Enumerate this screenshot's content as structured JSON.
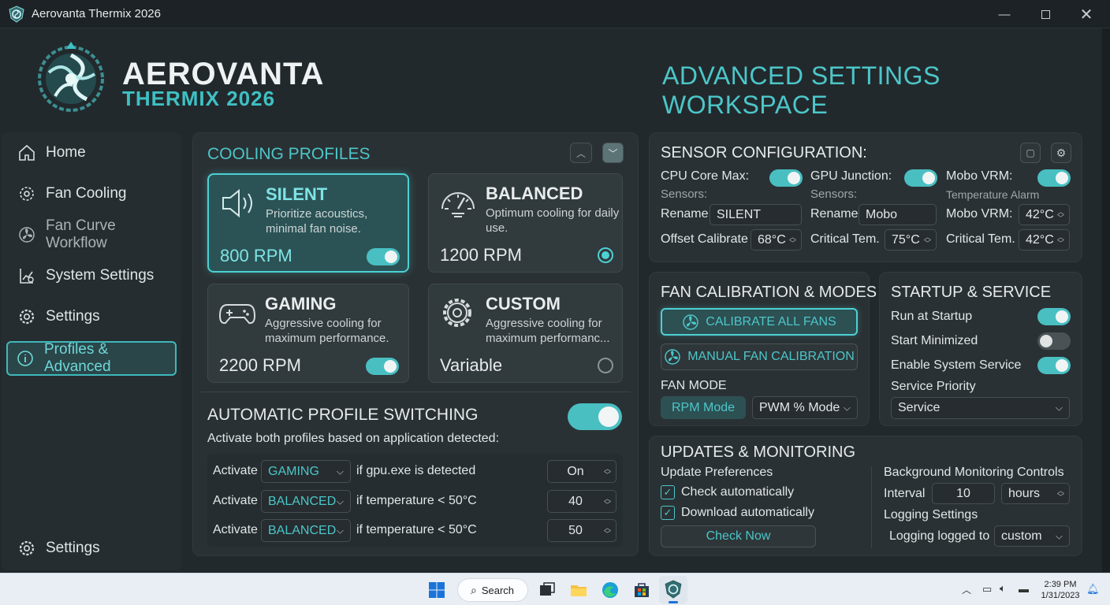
{
  "window": {
    "title": "Aerovanta Thermix 2026"
  },
  "brand": {
    "line1": "AEROVANTA",
    "line2": "THERMIX 2026"
  },
  "header": {
    "workspace_title": "ADVANCED SETTINGS WORKSPACE"
  },
  "sidebar": {
    "items": [
      {
        "label": "Home",
        "icon": "home-icon"
      },
      {
        "label": "Fan Cooling",
        "icon": "gear-fan-icon"
      },
      {
        "label": "Fan Curve Workflow",
        "icon": "fan-icon"
      },
      {
        "label": "System Settings",
        "icon": "system-settings-icon"
      },
      {
        "label": "Settings",
        "icon": "gear-icon"
      },
      {
        "label": "Profiles & Advanced",
        "icon": "info-icon",
        "active": true
      }
    ],
    "footer_label": "Settings"
  },
  "cooling_profiles": {
    "title": "COOLING PROFILES",
    "profiles": [
      {
        "name": "SILENT",
        "desc": "Prioritize acoustics, minimal fan noise.",
        "speed": "800 RPM",
        "control": "toggle",
        "on": true,
        "selected": true
      },
      {
        "name": "BALANCED",
        "desc": "Optimum cooling for daily use.",
        "speed": "1200 RPM",
        "control": "radio",
        "on": true
      },
      {
        "name": "GAMING",
        "desc": "Aggressive cooling for maximum performance.",
        "speed": "2200 RPM",
        "control": "toggle",
        "on": true
      },
      {
        "name": "CUSTOM",
        "desc": "Aggressive cooling for maximum performanc...",
        "speed": "Variable",
        "control": "radio",
        "on": false
      }
    ]
  },
  "auto_switch": {
    "title": "AUTOMATIC PROFILE SWITCHING",
    "subtitle": "Activate both profiles based on application detected:",
    "enabled": true,
    "rules": [
      {
        "prefix": "Activate",
        "profile": "GAMING",
        "condition": "if gpu.exe is detected",
        "value": "On"
      },
      {
        "prefix": "Activate",
        "profile": "BALANCED",
        "condition": "if temperature < 50°C",
        "value": "40"
      },
      {
        "prefix": "Activate",
        "profile": "BALANCED",
        "condition": "if temperature < 50°C",
        "value": "50"
      }
    ]
  },
  "sensor": {
    "title": "SENSOR CONFIGURATION:",
    "cols": [
      {
        "head": "CPU Core Max:",
        "sub": "Sensors:",
        "r1_label": "Rename",
        "r1_value": "SILENT",
        "r2_label": "Offset Calibrate",
        "r2_value": "68°C"
      },
      {
        "head": "GPU Junction:",
        "sub": "Sensors:",
        "r1_label": "Rename",
        "r1_value": "Mobo",
        "r2_label": "Critical Tem.",
        "r2_value": "75°C"
      },
      {
        "head": "Mobo VRM:",
        "sub": "Temperature Alarm",
        "r1_label": "Mobo VRM:",
        "r1_value": "42°C",
        "r2_label": "Critical Tem.",
        "r2_value": "42°C"
      }
    ]
  },
  "fan_calibration": {
    "title": "FAN CALIBRATION & MODES",
    "calibrate_all": "CALIBRATE ALL FANS",
    "manual": "MANUAL FAN CALIBRATION",
    "mode_label": "FAN MODE",
    "rpm_mode": "RPM Mode",
    "pwm_mode": "PWM % Mode"
  },
  "startup": {
    "title": "STARTUP & SERVICE",
    "run_at_startup": "Run at Startup",
    "start_minimized": "Start Minimized",
    "enable_service": "Enable System Service",
    "priority_label": "Service Priority",
    "priority_value": "Service"
  },
  "updates": {
    "title": "UPDATES & MONITORING",
    "prefs_label": "Update Preferences",
    "check_auto": "Check automatically",
    "download_auto": "Download automatically",
    "check_now": "Check Now",
    "bg_label": "Background Monitoring Controls",
    "interval_label": "Interval",
    "interval_value": "10",
    "interval_unit": "hours",
    "logging_label": "Logging Settings",
    "logged_to_label": "Logging logged to",
    "logged_to_value": "custom"
  },
  "taskbar": {
    "search": "Search",
    "time": "2:39 PM",
    "date": "1/31/2023"
  },
  "colors": {
    "accent": "#4cc6c9",
    "bg": "#22292c",
    "panel": "#2a3134"
  }
}
